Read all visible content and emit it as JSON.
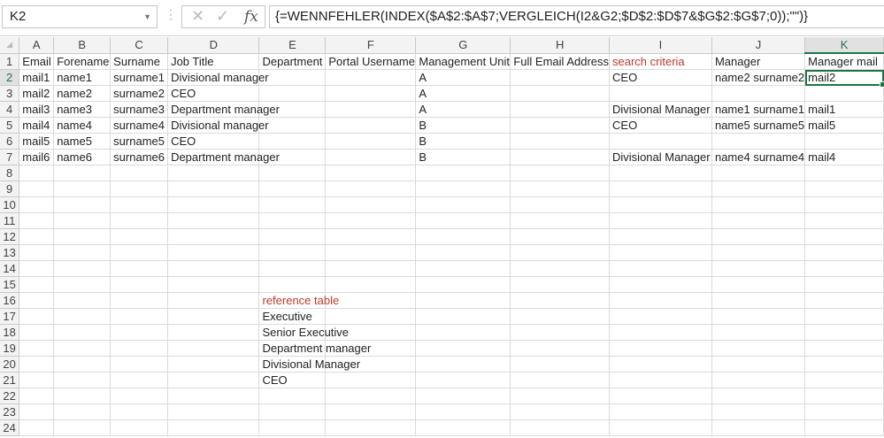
{
  "name_box": "K2",
  "formula": "{=WENNFEHLER(INDEX($A$2:$A$7;VERGLEICH(I2&G2;$D$2:$D$7&$G$2:$G$7;0));\"\")}",
  "icons": {
    "cancel": "cross-icon",
    "enter": "check-icon",
    "function": "fx-icon"
  },
  "fx_label": "fx",
  "selected_cell": {
    "column": "K",
    "row": 2
  },
  "accent_color": "#217346",
  "red_text_color": "#c0392b",
  "columns": [
    "A",
    "B",
    "C",
    "D",
    "E",
    "F",
    "G",
    "H",
    "I",
    "J",
    "K"
  ],
  "rows": [
    [
      "Email",
      "Forename",
      "Surname",
      "Job Title",
      "Department",
      "Portal Username",
      "Management Unit",
      "Full Email Address",
      "search criteria",
      "Manager",
      "Manager mail"
    ],
    [
      "mail1",
      "name1",
      "surname1",
      "Divisional manager",
      "",
      "",
      "A",
      "",
      "CEO",
      "name2 surname2",
      "mail2"
    ],
    [
      "mail2",
      "name2",
      "surname2",
      "CEO",
      "",
      "",
      "A",
      "",
      "",
      "",
      ""
    ],
    [
      "mail3",
      "name3",
      "surname3",
      "Department manager",
      "",
      "",
      "A",
      "",
      "Divisional Manager",
      "name1 surname1",
      "mail1"
    ],
    [
      "mail4",
      "name4",
      "surname4",
      "Divisional manager",
      "",
      "",
      "B",
      "",
      "CEO",
      "name5 surname5",
      "mail5"
    ],
    [
      "mail5",
      "name5",
      "surname5",
      "CEO",
      "",
      "",
      "B",
      "",
      "",
      "",
      ""
    ],
    [
      "mail6",
      "name6",
      "surname6",
      "Department manager",
      "",
      "",
      "B",
      "",
      "Divisional Manager",
      "name4 surname4",
      "mail4"
    ],
    [
      "",
      "",
      "",
      "",
      "",
      "",
      "",
      "",
      "",
      "",
      ""
    ],
    [
      "",
      "",
      "",
      "",
      "",
      "",
      "",
      "",
      "",
      "",
      ""
    ],
    [
      "",
      "",
      "",
      "",
      "",
      "",
      "",
      "",
      "",
      "",
      ""
    ],
    [
      "",
      "",
      "",
      "",
      "",
      "",
      "",
      "",
      "",
      "",
      ""
    ],
    [
      "",
      "",
      "",
      "",
      "",
      "",
      "",
      "",
      "",
      "",
      ""
    ],
    [
      "",
      "",
      "",
      "",
      "",
      "",
      "",
      "",
      "",
      "",
      ""
    ],
    [
      "",
      "",
      "",
      "",
      "",
      "",
      "",
      "",
      "",
      "",
      ""
    ],
    [
      "",
      "",
      "",
      "",
      "",
      "",
      "",
      "",
      "",
      "",
      ""
    ],
    [
      "",
      "",
      "",
      "",
      "reference table",
      "",
      "",
      "",
      "",
      "",
      ""
    ],
    [
      "",
      "",
      "",
      "",
      "Executive",
      "",
      "",
      "",
      "",
      "",
      ""
    ],
    [
      "",
      "",
      "",
      "",
      "Senior Executive",
      "",
      "",
      "",
      "",
      "",
      ""
    ],
    [
      "",
      "",
      "",
      "",
      "Department manager",
      "",
      "",
      "",
      "",
      "",
      ""
    ],
    [
      "",
      "",
      "",
      "",
      "Divisional Manager",
      "",
      "",
      "",
      "",
      "",
      ""
    ],
    [
      "",
      "",
      "",
      "",
      "CEO",
      "",
      "",
      "",
      "",
      "",
      ""
    ],
    [
      "",
      "",
      "",
      "",
      "",
      "",
      "",
      "",
      "",
      "",
      ""
    ],
    [
      "",
      "",
      "",
      "",
      "",
      "",
      "",
      "",
      "",
      "",
      ""
    ],
    [
      "",
      "",
      "",
      "",
      "",
      "",
      "",
      "",
      "",
      "",
      ""
    ]
  ],
  "red_cells": [
    "I1",
    "E16"
  ]
}
